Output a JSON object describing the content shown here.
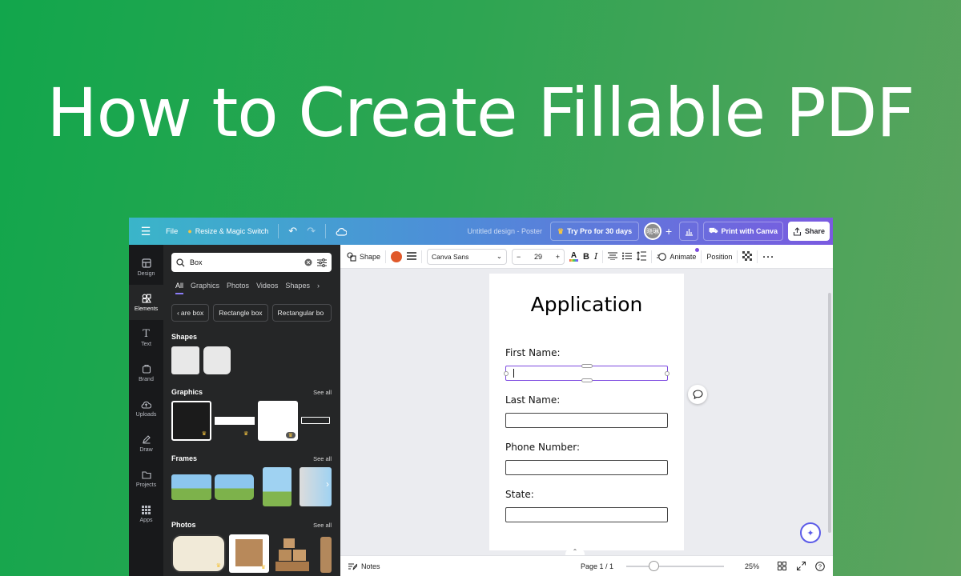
{
  "hero": {
    "title": "How to Create Fillable PDF"
  },
  "topbar": {
    "file": "File",
    "resize": "Resize & Magic Switch",
    "doc_title": "Untitled design - Poster",
    "try_pro": "Try Pro for 30 days",
    "avatar": "晓琳",
    "print": "Print with Canva",
    "share": "Share"
  },
  "rail": {
    "items": [
      {
        "label": "Design",
        "icon": "design-icon"
      },
      {
        "label": "Elements",
        "icon": "elements-icon"
      },
      {
        "label": "Text",
        "icon": "text-icon"
      },
      {
        "label": "Brand",
        "icon": "brand-icon"
      },
      {
        "label": "Uploads",
        "icon": "uploads-icon"
      },
      {
        "label": "Draw",
        "icon": "draw-icon"
      },
      {
        "label": "Projects",
        "icon": "projects-icon"
      },
      {
        "label": "Apps",
        "icon": "apps-icon"
      }
    ]
  },
  "panel": {
    "search_value": "Box",
    "tabs": [
      "All",
      "Graphics",
      "Photos",
      "Videos",
      "Shapes"
    ],
    "chips": [
      "are box",
      "Rectangle box",
      "Rectangular bo"
    ],
    "sections": {
      "shapes": "Shapes",
      "graphics": "Graphics",
      "frames": "Frames",
      "photos": "Photos"
    },
    "see_all": "See all"
  },
  "toolbar": {
    "shape": "Shape",
    "font": "Canva Sans",
    "font_size": "29",
    "animate": "Animate",
    "position": "Position",
    "colors": {
      "shape_color": "#e0592a"
    }
  },
  "document": {
    "title": "Application",
    "fields": [
      {
        "label": "First  Name:"
      },
      {
        "label": "Last  Name:"
      },
      {
        "label": "Phone Number:"
      },
      {
        "label": "State:"
      }
    ]
  },
  "bottombar": {
    "notes": "Notes",
    "page": "Page 1 / 1",
    "zoom": "25%"
  }
}
